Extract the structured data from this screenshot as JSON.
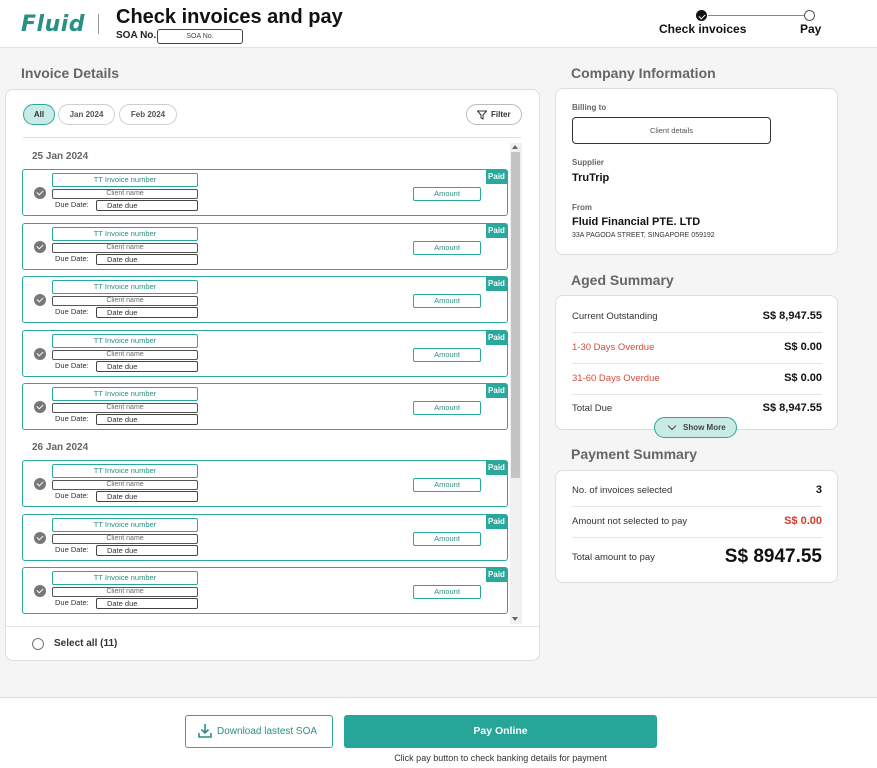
{
  "header": {
    "logo_text": "Fluid",
    "title": "Check invoices and pay",
    "soa_label": "SOA No.",
    "soa_placeholder": "SOA No.",
    "steps": [
      {
        "label": "Check invoices",
        "state": "done"
      },
      {
        "label": "Pay",
        "state": "pending"
      }
    ]
  },
  "invoice_details": {
    "title": "Invoice Details",
    "filters": [
      "All",
      "Jan 2024",
      "Feb 2024"
    ],
    "active_filter": "All",
    "filter_button": "Filter",
    "groups": [
      {
        "date": "25 Jan 2024",
        "invoices": [
          {
            "invoice_number": "TT Invoice number",
            "client": "Client name",
            "due_label": "Due Date:",
            "due": "Date due",
            "amount": "Amount",
            "status": "Paid"
          },
          {
            "invoice_number": "TT Invoice number",
            "client": "Client name",
            "due_label": "Due Date:",
            "due": "Date due",
            "amount": "Amount",
            "status": "Paid"
          },
          {
            "invoice_number": "TT Invoice number",
            "client": "Client name",
            "due_label": "Due Date:",
            "due": "Date due",
            "amount": "Amount",
            "status": "Paid"
          },
          {
            "invoice_number": "TT Invoice number",
            "client": "Client name",
            "due_label": "Due Date:",
            "due": "Date due",
            "amount": "Amount",
            "status": "Paid"
          },
          {
            "invoice_number": "TT Invoice number",
            "client": "Client name",
            "due_label": "Due Date:",
            "due": "Date due",
            "amount": "Amount",
            "status": "Paid"
          }
        ]
      },
      {
        "date": "26 Jan 2024",
        "invoices": [
          {
            "invoice_number": "TT Invoice number",
            "client": "Client name",
            "due_label": "Due Date:",
            "due": "Date due",
            "amount": "Amount",
            "status": "Paid"
          },
          {
            "invoice_number": "TT Invoice number",
            "client": "Client name",
            "due_label": "Due Date:",
            "due": "Date due",
            "amount": "Amount",
            "status": "Paid"
          },
          {
            "invoice_number": "TT Invoice number",
            "client": "Client name",
            "due_label": "Due Date:",
            "due": "Date due",
            "amount": "Amount",
            "status": "Paid"
          }
        ]
      }
    ],
    "select_all_label": "Select all (11)"
  },
  "company_info": {
    "title": "Company Information",
    "billing_label": "Billing to",
    "billing_placeholder": "Client details",
    "supplier_label": "Supplier",
    "supplier_value": "TruTrip",
    "from_label": "From",
    "from_value": "Fluid Financial PTE. LTD",
    "address": "33A PAGODA STREET, SINGAPORE 059192"
  },
  "aged_summary": {
    "title": "Aged Summary",
    "rows": [
      {
        "label": "Current Outstanding",
        "value": "S$ 8,947.55",
        "tone": "normal"
      },
      {
        "label": "1-30 Days Overdue",
        "value": "S$ 0.00",
        "tone": "overdue"
      },
      {
        "label": "31-60 Days Overdue",
        "value": "S$ 0.00",
        "tone": "overdue"
      },
      {
        "label": "Total Due",
        "value": "S$ 8,947.55",
        "tone": "normal"
      }
    ],
    "show_more": "Show More"
  },
  "payment_summary": {
    "title": "Payment Summary",
    "invoices_selected_label": "No. of invoices selected",
    "invoices_selected_value": "3",
    "not_selected_label": "Amount not selected to pay",
    "not_selected_value": "S$ 0.00",
    "total_label": "Total amount to pay",
    "total_value": "S$ 8947.55"
  },
  "footer": {
    "download_label": "Download lastest SOA",
    "pay_label": "Pay Online",
    "pay_hint": "Click pay button to check banking details for payment"
  },
  "colors": {
    "accent": "#26a599",
    "accent_light": "#c9ebe7",
    "overdue": "#d84b3b"
  }
}
